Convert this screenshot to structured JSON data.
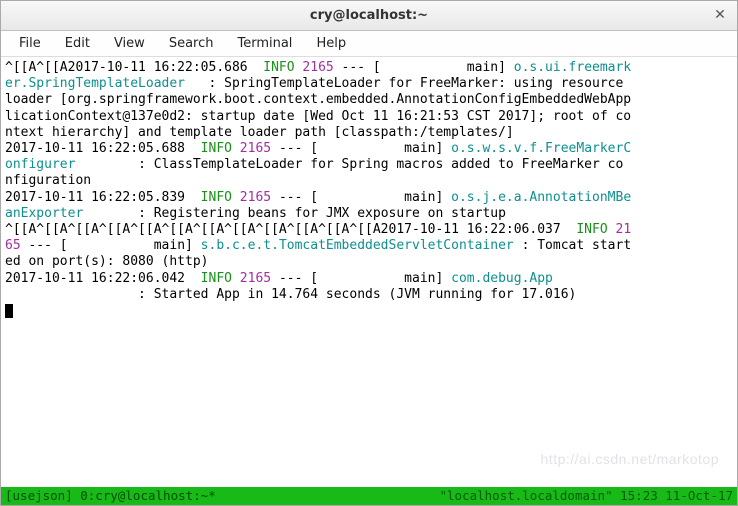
{
  "window": {
    "title": "cry@localhost:~"
  },
  "menu": {
    "file": "File",
    "edit": "Edit",
    "view": "View",
    "search": "Search",
    "terminal": "Terminal",
    "help": "Help"
  },
  "log": {
    "l1a": "^[[A^[[A2017-10-11 16:22:05.686  ",
    "l1b": "INFO",
    "l1c": " 2165",
    "l1d": " --- [           main] ",
    "l1e": "o.s.ui.freemark",
    "l2a": "er.SpringTemplateLoader",
    "l2b": "   : SpringTemplateLoader for FreeMarker: using resource ",
    "l3": "loader [org.springframework.boot.context.embedded.AnnotationConfigEmbeddedWebApp",
    "l4": "licationContext@137e0d2: startup date [Wed Oct 11 16:21:53 CST 2017]; root of co",
    "l5": "ntext hierarchy] and template loader path [classpath:/templates/]",
    "l6a": "2017-10-11 16:22:05.688  ",
    "l6b": "INFO",
    "l6c": " 2165",
    "l6d": " --- [           main] ",
    "l6e": "o.s.w.s.v.f.FreeMarkerC",
    "l7a": "onfigurer",
    "l7b": "        : ClassTemplateLoader for Spring macros added to FreeMarker co",
    "l8": "nfiguration",
    "l9a": "2017-10-11 16:22:05.839  ",
    "l9b": "INFO",
    "l9c": " 2165",
    "l9d": " --- [           main] ",
    "l9e": "o.s.j.e.a.AnnotationMBe",
    "l10a": "anExporter",
    "l10b": "       : Registering beans for JMX exposure on startup",
    "l11a": "^[[A^[[A^[[A^[[A^[[A^[[A^[[A^[[A^[[A^[[A^[[A^[[A2017-10-11 16:22:06.037  ",
    "l11b": "INFO",
    "l11c": " 21",
    "l12a": "65",
    "l12b": " --- [           main] ",
    "l12c": "s.b.c.e.t.TomcatEmbeddedServletContainer",
    "l12d": " : Tomcat start",
    "l13": "ed on port(s): 8080 (http)",
    "l14a": "2017-10-11 16:22:06.042  ",
    "l14b": "INFO",
    "l14c": " 2165",
    "l14d": " --- [           main] ",
    "l14e": "com.debug.App",
    "l15": "                 : Started App in 14.764 seconds (JVM running for 17.016)"
  },
  "status": {
    "left": "[usejson] 0:cry@localhost:~*",
    "right": "\"localhost.localdomain\" 15:23 11-Oct-17"
  },
  "watermark": "http://ai.csdn.net/markotop"
}
